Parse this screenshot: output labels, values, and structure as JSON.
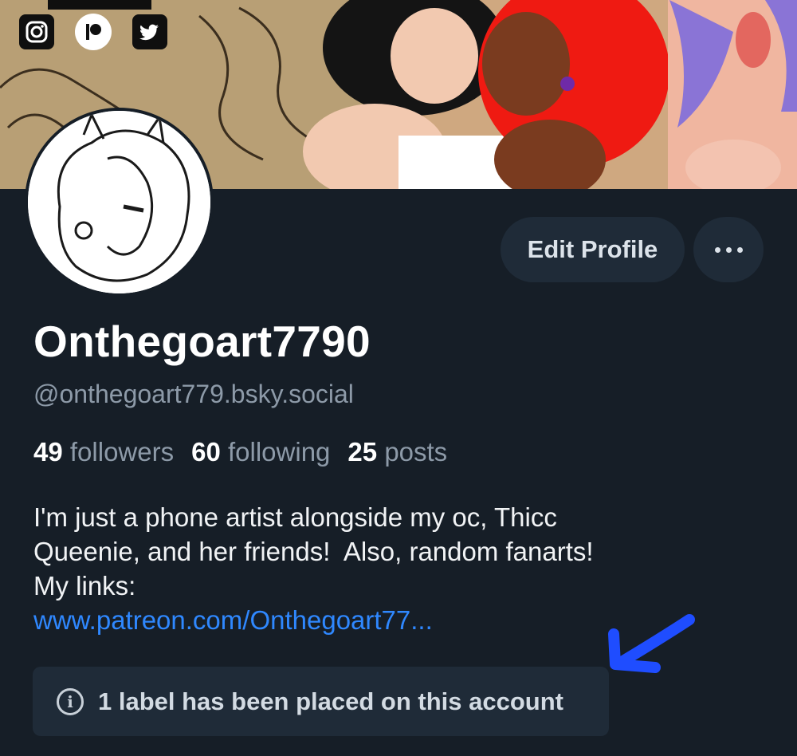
{
  "profile": {
    "display_name": "Onthegoart7790",
    "handle": "@onthegoart779.bsky.social",
    "followers_count": "49",
    "followers_label": "followers",
    "following_count": "60",
    "following_label": "following",
    "posts_count": "25",
    "posts_label": "posts",
    "bio_lines": [
      "I'm just a phone artist alongside my oc, Thicc",
      "Queenie, and her friends!  Also, random fanarts!",
      "My links:"
    ],
    "bio_link": "www.patreon.com/Onthegoart77..."
  },
  "actions": {
    "edit_profile_label": "Edit Profile",
    "more_icon": "ellipsis-icon"
  },
  "banner": {
    "social_icons": [
      "instagram-icon",
      "patreon-icon",
      "twitter-icon"
    ]
  },
  "label_notice": {
    "text": "1 label has been placed on this account",
    "icon": "info-icon"
  },
  "colors": {
    "background": "#161e27",
    "button_bg": "#1f2b38",
    "muted_text": "#8d9aa8",
    "link": "#2f88ff",
    "annotation_arrow": "#1f4dff"
  }
}
